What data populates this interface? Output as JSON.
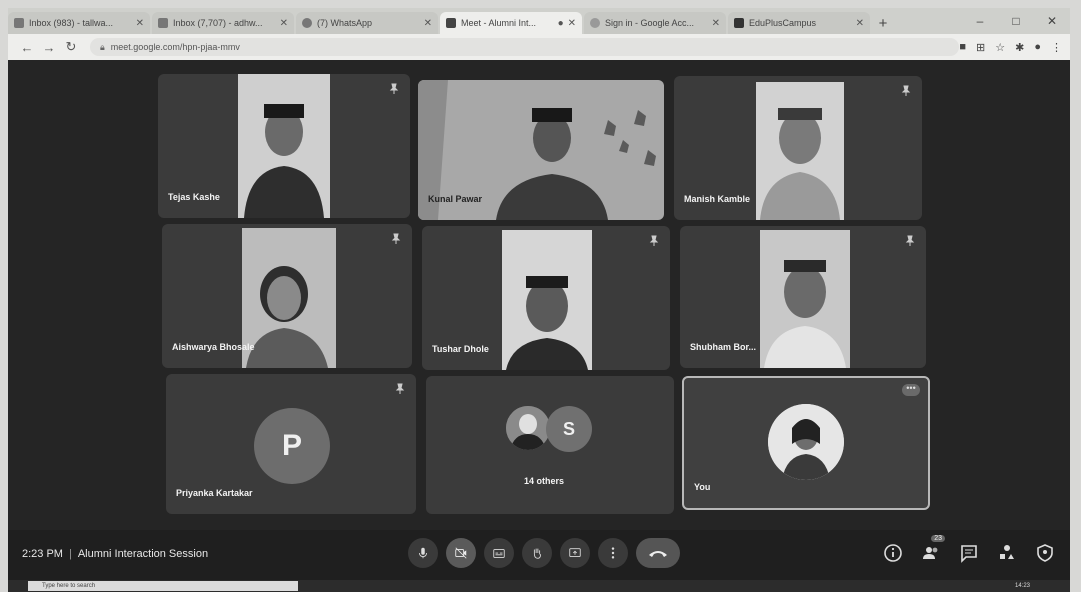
{
  "browser": {
    "tabs": [
      {
        "label": "Inbox (983) - tallwa...",
        "icon": "gmail-icon",
        "active": false
      },
      {
        "label": "Inbox (7,707) - adhw...",
        "icon": "gmail-icon",
        "active": false
      },
      {
        "label": "(7) WhatsApp",
        "icon": "whatsapp-icon",
        "active": false
      },
      {
        "label": "Meet - Alumni Int...",
        "icon": "meet-icon",
        "active": true
      },
      {
        "label": "Sign in - Google Acc...",
        "icon": "google-icon",
        "active": false
      },
      {
        "label": "EduPlusCampus",
        "icon": "app-icon",
        "active": false
      }
    ],
    "new_tab": "+",
    "window_controls": [
      "–",
      "□",
      "✕"
    ],
    "url": "meet.google.com/hpn-pjaa-mmv"
  },
  "participants": [
    {
      "name": "Tejas Kashe",
      "type": "video"
    },
    {
      "name": "Kunal Pawar",
      "type": "video"
    },
    {
      "name": "Manish Kamble",
      "type": "video"
    },
    {
      "name": "Aishwarya Bhosale",
      "type": "video"
    },
    {
      "name": "Tushar Dhole",
      "type": "video"
    },
    {
      "name": "Shubham Bor...",
      "type": "video"
    },
    {
      "name": "Priyanka Kartakar",
      "type": "avatar",
      "initial": "P"
    },
    {
      "name": "14 others",
      "type": "group",
      "initial": "S"
    },
    {
      "name": "You",
      "type": "self"
    }
  ],
  "bottom": {
    "time": "2:23 PM",
    "meeting_title": "Alumni Interaction Session",
    "people_count": "23"
  },
  "taskbar": {
    "search_placeholder": "Type here to search",
    "clock": "14:23"
  }
}
